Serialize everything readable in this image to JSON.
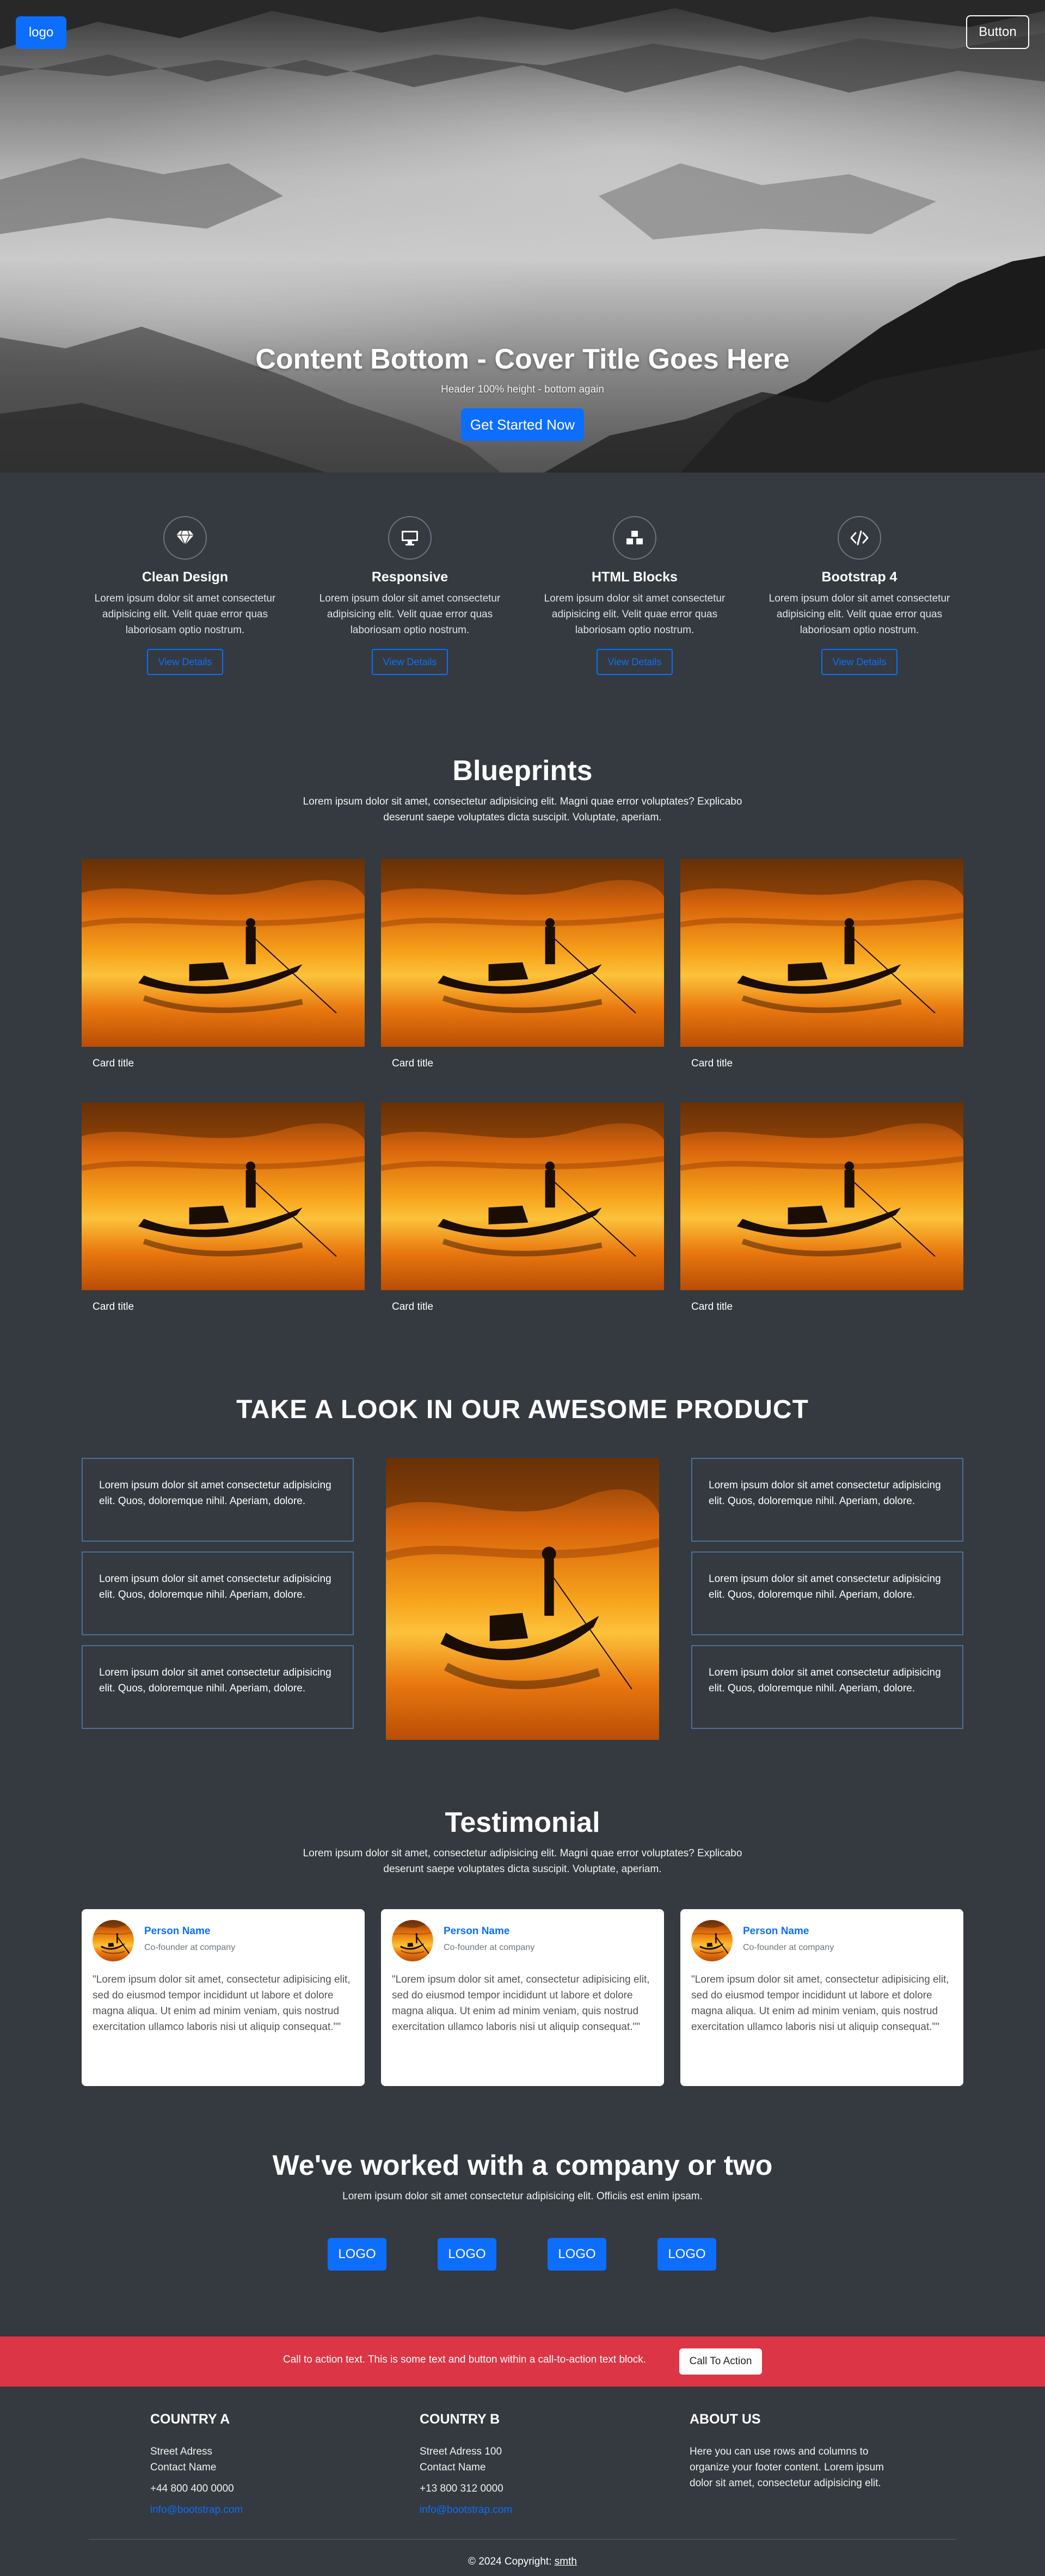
{
  "header": {
    "logo_label": "logo",
    "button_label": "Button",
    "title": "Content Bottom - Cover Title Goes Here",
    "subtitle": "Header 100% height - bottom again",
    "cta_label": "Get Started Now"
  },
  "features": [
    {
      "icon": "gem-icon",
      "title": "Clean Design",
      "text": "Lorem ipsum dolor sit amet consectetur adipisicing elit. Velit quae error quas laboriosam optio nostrum.",
      "button": "View Details"
    },
    {
      "icon": "monitor-icon",
      "title": "Responsive",
      "text": "Lorem ipsum dolor sit amet consectetur adipisicing elit. Velit quae error quas laboriosam optio nostrum.",
      "button": "View Details"
    },
    {
      "icon": "boxes-icon",
      "title": "HTML Blocks",
      "text": "Lorem ipsum dolor sit amet consectetur adipisicing elit. Velit quae error quas laboriosam optio nostrum.",
      "button": "View Details"
    },
    {
      "icon": "code-icon",
      "title": "Bootstrap 4",
      "text": "Lorem ipsum dolor sit amet consectetur adipisicing elit. Velit quae error quas laboriosam optio nostrum.",
      "button": "View Details"
    }
  ],
  "blueprints": {
    "title": "Blueprints",
    "description": "Lorem ipsum dolor sit amet, consectetur adipisicing elit. Magni quae error voluptates? Explicabo deserunt saepe voluptates dicta suscipit. Voluptate, aperiam.",
    "cards": [
      {
        "title": "Card title"
      },
      {
        "title": "Card title"
      },
      {
        "title": "Card title"
      },
      {
        "title": "Card title"
      },
      {
        "title": "Card title"
      },
      {
        "title": "Card title"
      }
    ]
  },
  "product": {
    "title": "TAKE A LOOK IN OUR AWESOME PRODUCT",
    "left": [
      "Lorem ipsum dolor sit amet consectetur adipisicing elit. Quos, doloremque nihil. Aperiam, dolore.",
      "Lorem ipsum dolor sit amet consectetur adipisicing elit. Quos, doloremque nihil. Aperiam, dolore.",
      "Lorem ipsum dolor sit amet consectetur adipisicing elit. Quos, doloremque nihil. Aperiam, dolore."
    ],
    "right": [
      "Lorem ipsum dolor sit amet consectetur adipisicing elit. Quos, doloremque nihil. Aperiam, dolore.",
      "Lorem ipsum dolor sit amet consectetur adipisicing elit. Quos, doloremque nihil. Aperiam, dolore.",
      "Lorem ipsum dolor sit amet consectetur adipisicing elit. Quos, doloremque nihil. Aperiam, dolore."
    ]
  },
  "testimonial": {
    "title": "Testimonial",
    "description": "Lorem ipsum dolor sit amet, consectetur adipisicing elit. Magni quae error voluptates? Explicabo deserunt saepe voluptates dicta suscipit. Voluptate, aperiam.",
    "cards": [
      {
        "name": "Person Name",
        "role": "Co-founder at company",
        "quote": "\"Lorem ipsum dolor sit amet, consectetur adipisicing elit, sed do eiusmod tempor incididunt ut labore et dolore magna aliqua. Ut enim ad minim veniam, quis nostrud exercitation ullamco laboris nisi ut aliquip consequat.\"\""
      },
      {
        "name": "Person Name",
        "role": "Co-founder at company",
        "quote": "\"Lorem ipsum dolor sit amet, consectetur adipisicing elit, sed do eiusmod tempor incididunt ut labore et dolore magna aliqua. Ut enim ad minim veniam, quis nostrud exercitation ullamco laboris nisi ut aliquip consequat.\"\""
      },
      {
        "name": "Person Name",
        "role": "Co-founder at company",
        "quote": "\"Lorem ipsum dolor sit amet, consectetur adipisicing elit, sed do eiusmod tempor incididunt ut labore et dolore magna aliqua. Ut enim ad minim veniam, quis nostrud exercitation ullamco laboris nisi ut aliquip consequat.\"\""
      }
    ]
  },
  "clients": {
    "title": "We've worked with a company or two",
    "description": "Lorem ipsum dolor sit amet consectetur adipisicing elit. Officiis est enim ipsam.",
    "logos": [
      "LOGO",
      "LOGO",
      "LOGO",
      "LOGO"
    ]
  },
  "cta": {
    "text": "Call to action text. This is some text and button within a call-to-action text block.",
    "button": "Call To Action"
  },
  "footer": {
    "columns": [
      {
        "title": "COUNTRY A",
        "street": "Street Adress",
        "contact": "Contact Name",
        "phone": "+44 800 400 0000",
        "email": "info@bootstrap.com"
      },
      {
        "title": "COUNTRY B",
        "street": "Street Adress 100",
        "contact": "Contact Name",
        "phone": "+13 800 312 0000",
        "email": "info@bootstrap.com"
      }
    ],
    "about": {
      "title": "ABOUT US",
      "text": "Here you can use rows and columns to organize your footer content. Lorem ipsum dolor sit amet, consectetur adipisicing elit."
    },
    "copyright_prefix": "© 2024 Copyright: ",
    "copyright_link": "smth"
  },
  "colors": {
    "primary": "#0d6efd",
    "dark": "#343a40",
    "danger": "#dc3545",
    "white": "#ffffff"
  }
}
